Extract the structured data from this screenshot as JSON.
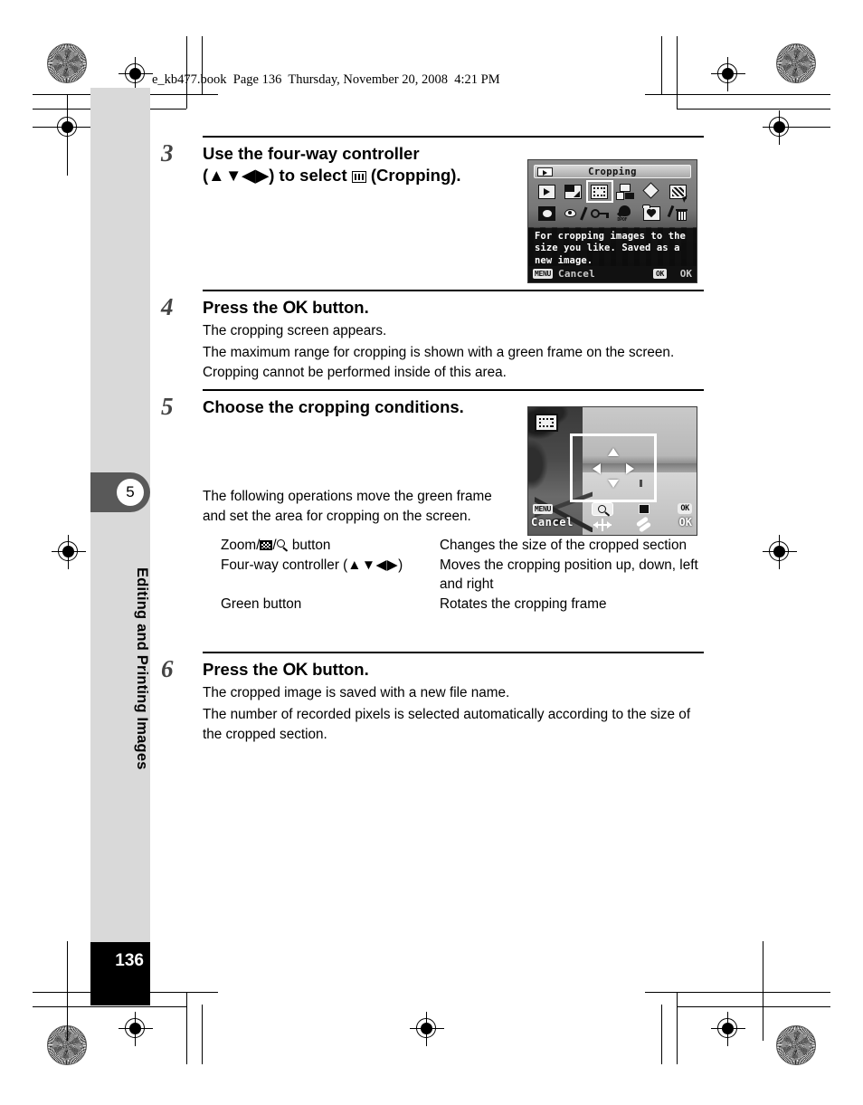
{
  "book_header": "e_kb477.book  Page 136  Thursday, November 20, 2008  4:21 PM",
  "sidebar": {
    "chapter_number": "5",
    "chapter_title": "Editing and Printing Images",
    "page_number": "136"
  },
  "steps": [
    {
      "number": "3",
      "title_part1": "Use the four-way controller",
      "title_part2_pre": "(",
      "title_arrows": "▲▼◀▶",
      "title_part2_post": ") to select",
      "title_part3": "(Cropping)."
    },
    {
      "number": "4",
      "title_pre": "Press the",
      "title_ok": "OK",
      "title_post": "button.",
      "paragraphs": [
        "The cropping screen appears.",
        "The maximum range for cropping is shown with a green frame on the screen. Cropping cannot be performed inside of this area."
      ]
    },
    {
      "number": "5",
      "title": "Choose the cropping conditions.",
      "paragraph": "The following operations move the green frame and set the area for cropping on the screen.",
      "operations": [
        {
          "key_pre": "Zoom/",
          "key_mid": "/",
          "key_post": " button",
          "value": "Changes the size of the cropped section"
        },
        {
          "key_pre": "Four-way controller (",
          "key_arrows": "▲▼◀▶",
          "key_post": ")",
          "value": "Moves the cropping position up, down, left and right"
        },
        {
          "key_pre": "Green button",
          "value": "Rotates the cropping frame"
        }
      ]
    },
    {
      "number": "6",
      "title_pre": "Press the",
      "title_ok": "OK",
      "title_post": "button.",
      "paragraphs": [
        "The cropped image is saved with a new file name.",
        "The number of recorded pixels is selected automatically according to the size of the cropped section."
      ]
    }
  ],
  "camera_menu_screen": {
    "title": "Cropping",
    "tab_icon": "playback-mode-icon",
    "icons_row1": [
      "slideshow-icon",
      "resize-icon",
      "cropping-icon",
      "image-copy-icon",
      "image-rotation-icon",
      "digital-filter-icon"
    ],
    "icons_row2": [
      "frame-composite-icon",
      "red-eye-compensation-icon",
      "protect-icon",
      "dpof-icon",
      "favorites-icon",
      "delete-icon"
    ],
    "selected_icon": "cropping-icon",
    "help_text": "For cropping images to the size you like. Saved as a new image.",
    "menu_badge": "MENU",
    "cancel_label": "Cancel",
    "ok_badge": "OK",
    "ok_label": "OK"
  },
  "camera_crop_screen": {
    "mode_icon": "cropping-icon",
    "menu_badge": "MENU",
    "cancel_label": "Cancel",
    "zoom_icon": "magnifier-icon",
    "resize_icon": "resize-arrows-icon",
    "green_button_icon": "green-button-icon",
    "rotate_icon": "rotate-icon",
    "ok_badge": "OK",
    "ok_label": "OK"
  },
  "colors": {
    "sidebar_band": "#d9d9d9",
    "chapter_tab": "#595959",
    "page_block": "#000000",
    "text": "#000000"
  }
}
